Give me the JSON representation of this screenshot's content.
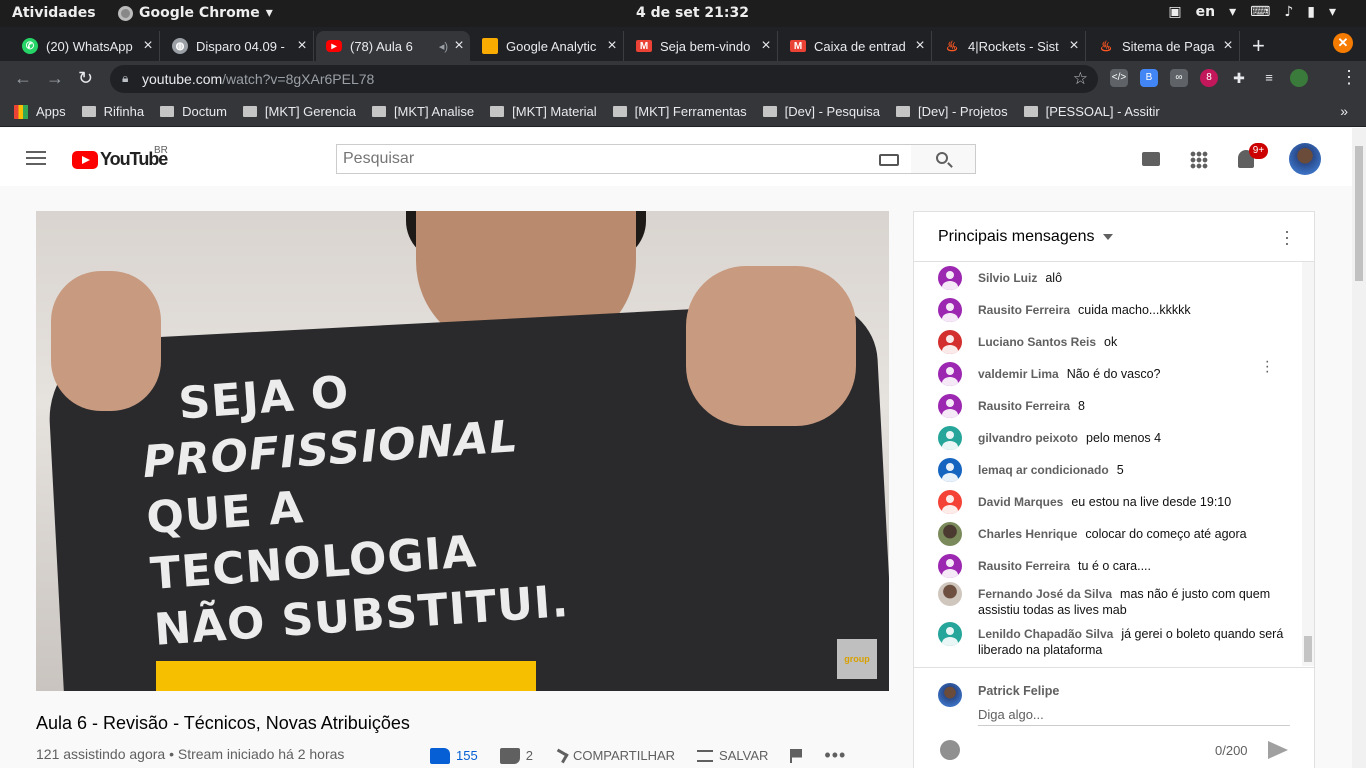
{
  "system": {
    "activities": "Atividades",
    "app_name": "Google Chrome",
    "clock": "4 de set  21:32",
    "lang": "en"
  },
  "tabs": [
    {
      "title": "(20) WhatsApp",
      "icon": "whatsapp-icon",
      "color": "#25d366"
    },
    {
      "title": "Disparo 04.09 -",
      "icon": "globe-icon",
      "color": "#9aa0a6"
    },
    {
      "title": "(78) Aula 6",
      "icon": "youtube-icon",
      "color": "#ff0000",
      "active": true
    },
    {
      "title": "Google Analytic",
      "icon": "analytics-icon",
      "color": "#f9ab00"
    },
    {
      "title": "Seja bem-vindo",
      "icon": "gmail-icon",
      "color": "#ea4335"
    },
    {
      "title": "Caixa de entrad",
      "icon": "gmail-icon",
      "color": "#ea4335"
    },
    {
      "title": "4|Rockets - Sist",
      "icon": "flame-icon",
      "color": "#ff5722"
    },
    {
      "title": "Sitema de Paga",
      "icon": "flame-icon",
      "color": "#ff5722"
    }
  ],
  "address": {
    "host": "youtube.com",
    "path": "/watch?v=8gXAr6PEL78"
  },
  "bookmarks": [
    "Apps",
    "Rifinha",
    "Doctum",
    "[MKT] Gerencia",
    "[MKT] Analise",
    "[MKT] Material",
    "[MKT] Ferramentas",
    "[Dev] - Pesquisa",
    "[Dev] - Projetos",
    "[PESSOAL] - Assitir"
  ],
  "youtube": {
    "logo": "YouTube",
    "country": "BR",
    "search_placeholder": "Pesquisar",
    "notifications": "9+"
  },
  "video": {
    "shirt_lines": [
      "SEJA O",
      "PROFISSIONAL",
      "QUE A",
      "TECNOLOGIA",
      "NÃO SUBSTITUI."
    ],
    "watermark": "group",
    "title": "Aula 6 - Revisão - Técnicos, Novas Atribuições",
    "meta": "121 assistindo agora • Stream iniciado há 2 horas",
    "likes": "155",
    "dislikes": "2",
    "share": "COMPARTILHAR",
    "save": "SALVAR",
    "more": "•••"
  },
  "chat": {
    "title": "Principais mensagens",
    "messages": [
      {
        "author": "Silvio Luiz",
        "text": "alô",
        "color": "#9c27b0"
      },
      {
        "author": "Rausito Ferreira",
        "text": "cuida macho...kkkkk",
        "color": "#9c27b0"
      },
      {
        "author": "Luciano Santos Reis",
        "text": "ok",
        "color": "#d32f2f"
      },
      {
        "author": "valdemir Lima",
        "text": "Não é do vasco?",
        "color": "#9c27b0"
      },
      {
        "author": "Rausito Ferreira",
        "text": "8",
        "color": "#9c27b0"
      },
      {
        "author": "gilvandro peixoto",
        "text": "pelo menos 4",
        "color": "#26a69a"
      },
      {
        "author": "lemaq ar condicionado",
        "text": "5",
        "color": "#1565c0"
      },
      {
        "author": "David Marques",
        "text": "eu estou na live desde 19:10",
        "color": "#f44336"
      },
      {
        "author": "Charles Henrique",
        "text": "colocar do começo até agora",
        "color": "#5d6b4a",
        "photo": true
      },
      {
        "author": "Rausito Ferreira",
        "text": "tu é o cara....",
        "color": "#9c27b0"
      },
      {
        "author": "Fernando José da Silva",
        "text": "mas não é justo com quem assistiu todas as lives mab",
        "color": "#a1887f",
        "photo": true
      },
      {
        "author": "Lenildo Chapadão Silva",
        "text": "já gerei o boleto quando será liberado na plataforma",
        "color": "#26a69a"
      }
    ],
    "me": "Patrick Felipe",
    "input_placeholder": "Diga algo...",
    "char_count": "0/200"
  }
}
